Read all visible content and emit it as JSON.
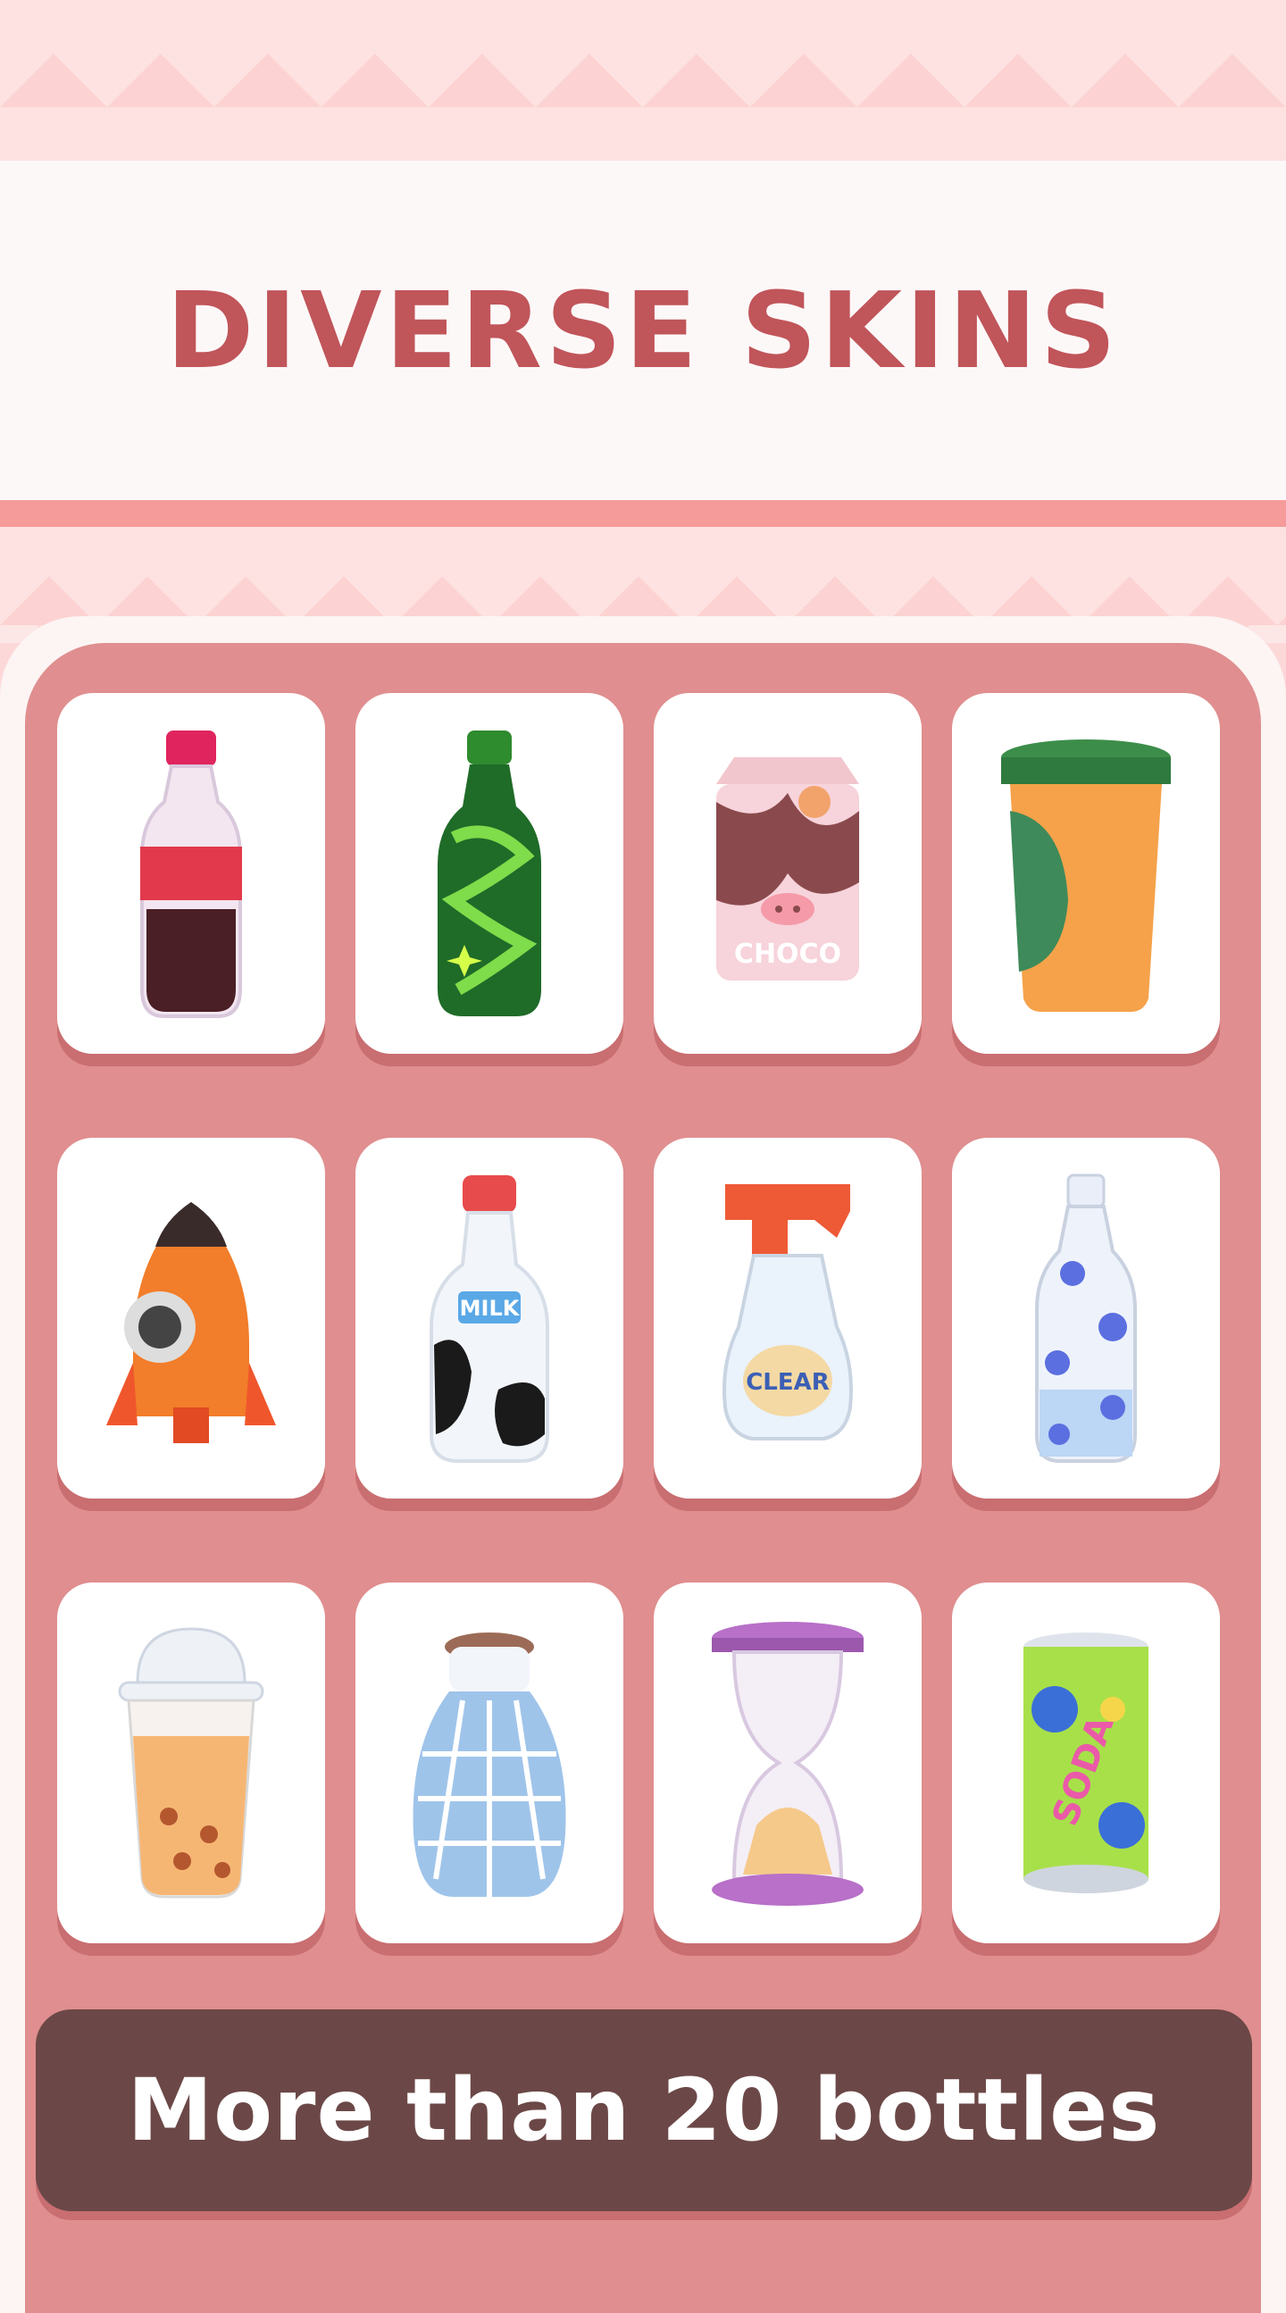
{
  "header": {
    "title": "DIVERSE SKINS"
  },
  "skins": [
    {
      "name": "cola-bottle-icon"
    },
    {
      "name": "green-soda-bottle-icon"
    },
    {
      "name": "choco-milk-carton-icon",
      "label": "CHOCO"
    },
    {
      "name": "tumbler-cup-icon"
    },
    {
      "name": "rocket-bottle-icon"
    },
    {
      "name": "milk-bottle-icon",
      "label": "MILK"
    },
    {
      "name": "spray-bottle-icon",
      "label": "CLEAR"
    },
    {
      "name": "flower-water-bottle-icon"
    },
    {
      "name": "bubble-tea-cup-icon"
    },
    {
      "name": "cork-vase-bottle-icon"
    },
    {
      "name": "hourglass-icon"
    },
    {
      "name": "soda-can-icon",
      "label": "SODA"
    }
  ],
  "footer": {
    "text": "More than 20 bottles"
  },
  "colors": {
    "title": "#c0555a",
    "panel": "#e08e8f",
    "footer_bg": "#6b4847"
  }
}
